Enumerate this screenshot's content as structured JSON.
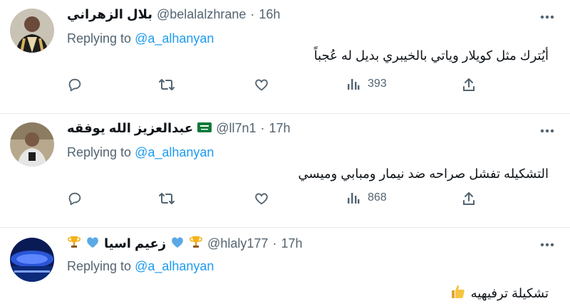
{
  "tweets": [
    {
      "name": "بلال الزهراني",
      "handle": "@belalalzhrane",
      "separator": "·",
      "time": "16h",
      "replying_prefix": "Replying to",
      "replying_to": "@a_alhanyan",
      "text": "أيُترك مثل كويلار وياتي بالخيبري بديل له عُجباً",
      "views": "393"
    },
    {
      "name": "عبدالعزيز الله يوفقه",
      "handle": "@ll7n1",
      "separator": "·",
      "time": "17h",
      "replying_prefix": "Replying to",
      "replying_to": "@a_alhanyan",
      "text": "التشكيله تفشل صراحه ضد نيمار ومبابي وميسي",
      "views": "868"
    },
    {
      "name": "زعيم اسيا",
      "handle": "@hlaly177",
      "separator": "·",
      "time": "17h",
      "replying_prefix": "Replying to",
      "replying_to": "@a_alhanyan",
      "text": "تشكيلة ترفيهيه"
    }
  ],
  "colors": {
    "accent": "#1d9bf0",
    "muted": "#536471",
    "text": "#0f1419"
  },
  "icons": [
    "more-icon",
    "reply-icon",
    "retweet-icon",
    "like-icon",
    "views-icon",
    "share-icon",
    "saudi-flag-icon",
    "trophy-icon",
    "blue-heart-icon",
    "thumbs-up-icon"
  ]
}
